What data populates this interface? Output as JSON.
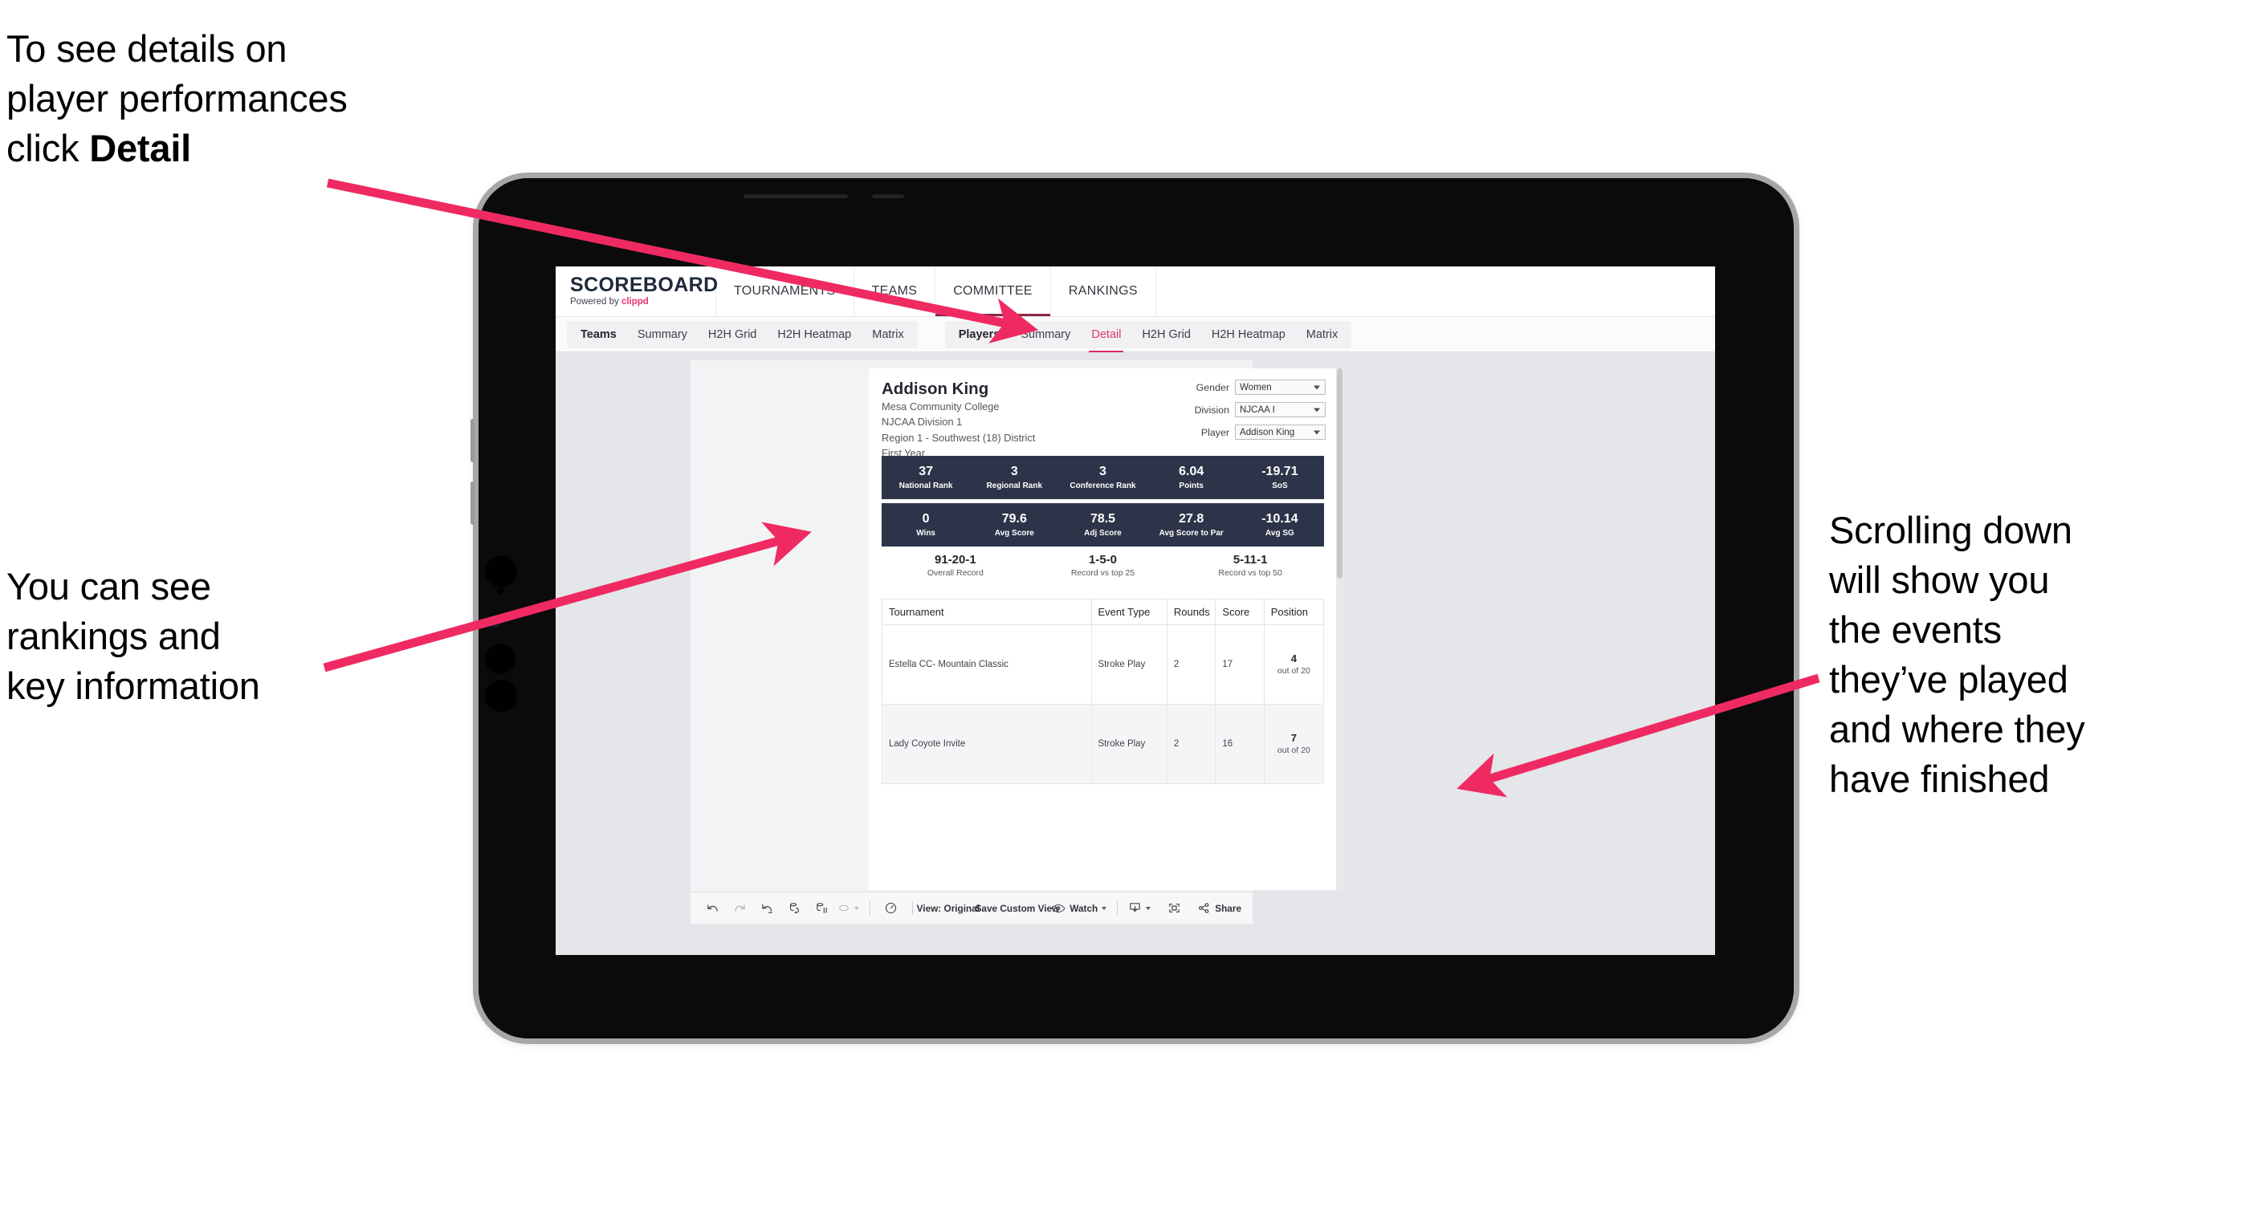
{
  "annotations": {
    "top_left": "To see details on\nplayer performances\nclick ",
    "top_left_bold": "Detail",
    "bottom_left": "You can see\nrankings and\nkey information",
    "right": "Scrolling down\nwill show you\nthe events\nthey’ve played\nand where they\nhave finished"
  },
  "app": {
    "logo": {
      "title": "SCOREBOARD",
      "powered_prefix": "Powered by ",
      "powered_brand": "clippd"
    },
    "top_nav": [
      {
        "label": "TOURNAMENTS",
        "active": false
      },
      {
        "label": "TEAMS",
        "active": false
      },
      {
        "label": "COMMITTEE",
        "active": true
      },
      {
        "label": "RANKINGS",
        "active": false
      }
    ],
    "sub_tabs": {
      "teams_group": [
        {
          "label": "Teams",
          "type": "group-label"
        },
        {
          "label": "Summary",
          "type": "tab"
        },
        {
          "label": "H2H Grid",
          "type": "tab"
        },
        {
          "label": "H2H Heatmap",
          "type": "tab"
        },
        {
          "label": "Matrix",
          "type": "tab"
        }
      ],
      "players_group": [
        {
          "label": "Players",
          "type": "group-label"
        },
        {
          "label": "Summary",
          "type": "tab"
        },
        {
          "label": "Detail",
          "type": "tab",
          "selected": true
        },
        {
          "label": "H2H Grid",
          "type": "tab"
        },
        {
          "label": "H2H Heatmap",
          "type": "tab"
        },
        {
          "label": "Matrix",
          "type": "tab"
        }
      ]
    },
    "colors": {
      "accent_pink": "#e0386b",
      "stat_bar_navy": "#2d3449",
      "brand_red": "#e8336d"
    }
  },
  "player": {
    "name": "Addison King",
    "school": "Mesa Community College",
    "division": "NJCAA Division 1",
    "region": "Region 1 - Southwest (18) District",
    "year": "First Year"
  },
  "filters": [
    {
      "label": "Gender",
      "value": "Women"
    },
    {
      "label": "Division",
      "value": "NJCAA I"
    },
    {
      "label": "Player",
      "value": "Addison King"
    }
  ],
  "stats_row_1": [
    {
      "value": "37",
      "label": "National Rank"
    },
    {
      "value": "3",
      "label": "Regional Rank"
    },
    {
      "value": "3",
      "label": "Conference Rank"
    },
    {
      "value": "6.04",
      "label": "Points"
    },
    {
      "value": "-19.71",
      "label": "SoS"
    }
  ],
  "stats_row_2": [
    {
      "value": "0",
      "label": "Wins"
    },
    {
      "value": "79.6",
      "label": "Avg Score"
    },
    {
      "value": "78.5",
      "label": "Adj Score"
    },
    {
      "value": "27.8",
      "label": "Avg Score to Par"
    },
    {
      "value": "-10.14",
      "label": "Avg SG"
    }
  ],
  "records": [
    {
      "value": "91-20-1",
      "label": "Overall Record"
    },
    {
      "value": "1-5-0",
      "label": "Record vs top 25"
    },
    {
      "value": "5-11-1",
      "label": "Record vs top 50"
    }
  ],
  "tournaments_table": {
    "headers": [
      "Tournament",
      "Event Type",
      "Rounds",
      "Score",
      "Position"
    ],
    "rows": [
      {
        "tournament": "Estella CC- Mountain Classic",
        "event_type": "Stroke Play",
        "rounds": "2",
        "score": "17",
        "position_num": "4",
        "position_of": "out of 20"
      },
      {
        "tournament": "Lady Coyote Invite",
        "event_type": "Stroke Play",
        "rounds": "2",
        "score": "16",
        "position_num": "7",
        "position_of": "out of 20"
      }
    ]
  },
  "toolbar": {
    "view_label": "View: Original",
    "save_custom_view_label": "Save Custom View",
    "watch_label": "Watch",
    "share_label": "Share"
  }
}
